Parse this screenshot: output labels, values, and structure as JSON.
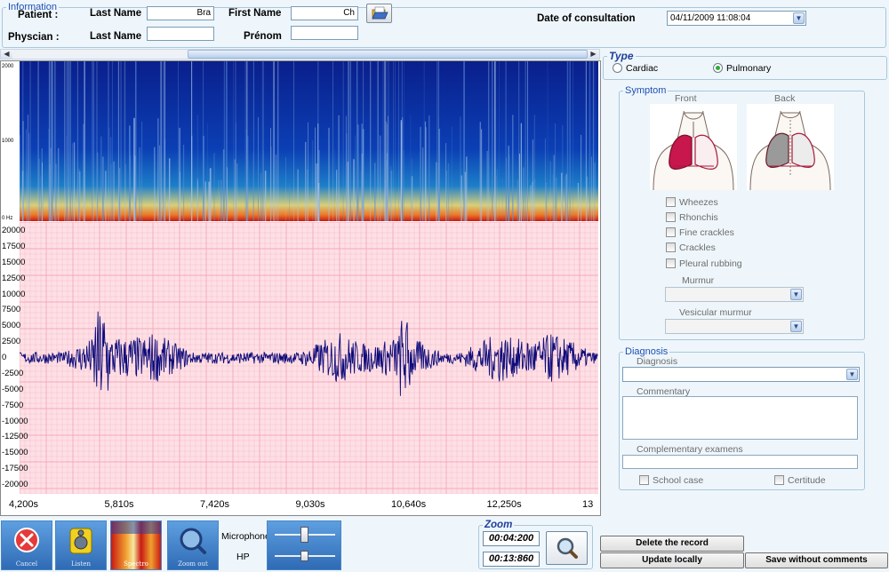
{
  "information": {
    "legend": "Information",
    "patient_label": "Patient :",
    "physician_label": "Physcian :",
    "patient_last_name_label": "Last Name",
    "patient_last_name_value": "Bra",
    "patient_first_name_label": "First Name",
    "patient_first_name_value": "Ch",
    "physician_last_name_label": "Last Name",
    "physician_last_name_value": "",
    "physician_prenom_label": "Prénom",
    "physician_prenom_value": "",
    "date_label": "Date of consultation",
    "date_value": "04/11/2009 11:08:04"
  },
  "spectrogram": {
    "y_top": "2000",
    "y_mid": "1000",
    "y_bottom": "0 Hz"
  },
  "waveform": {
    "y_ticks": [
      "20000",
      "17500",
      "15000",
      "12500",
      "10000",
      "7500",
      "5000",
      "2500",
      "0",
      "-2500",
      "-5000",
      "-7500",
      "-10000",
      "-12500",
      "-15000",
      "-17500",
      "-20000"
    ],
    "x_ticks": [
      "4,200s",
      "5,810s",
      "7,420s",
      "9,030s",
      "10,640s",
      "12,250s",
      "13"
    ],
    "colors": {
      "background": "#fde0e6",
      "grid": "#f6a9b8",
      "signal": "#0d0b7a"
    }
  },
  "type": {
    "legend": "Type",
    "options": [
      "Cardiac",
      "Pulmonary"
    ],
    "selected": "Pulmonary"
  },
  "symptom": {
    "legend": "Symptom",
    "front_label": "Front",
    "back_label": "Back",
    "checks": [
      {
        "label": "Wheezes",
        "checked": false
      },
      {
        "label": "Rhonchis",
        "checked": false
      },
      {
        "label": "Fine crackles",
        "checked": false
      },
      {
        "label": "Crackles",
        "checked": false
      },
      {
        "label": "Pleural rubbing",
        "checked": false
      }
    ],
    "murmur_label": "Murmur",
    "murmur_value": "",
    "vesicular_label": "Vesicular murmur",
    "vesicular_value": ""
  },
  "diagnosis": {
    "legend": "Diagnosis",
    "diagnosis_label": "Diagnosis",
    "diagnosis_value": "",
    "commentary_label": "Commentary",
    "commentary_value": "",
    "complementary_label": "Complementary examens",
    "complementary_value": "",
    "school_case_label": "School case",
    "certitude_label": "Certitude"
  },
  "toolbar": {
    "cancel_label": "Cancel",
    "listen_label": "Listen",
    "spectro_label": "Spectro",
    "zoom_out_label": "Zoom out",
    "microphone_label": "Microphone",
    "hp_label": "HP"
  },
  "zoom": {
    "legend": "Zoom",
    "start": "00:04:200",
    "end": "00:13:860"
  },
  "actions": {
    "delete_label": "Delete the record",
    "update_label": "Update locally",
    "save_label": "Save without comments"
  },
  "icons": {
    "open": "folder-open-icon",
    "cancel": "x-circle-icon",
    "listen": "speaker-icon",
    "spectro": "spectrogram-icon",
    "zoom_out": "magnifier-icon",
    "zoom_search": "magnifier-icon"
  }
}
